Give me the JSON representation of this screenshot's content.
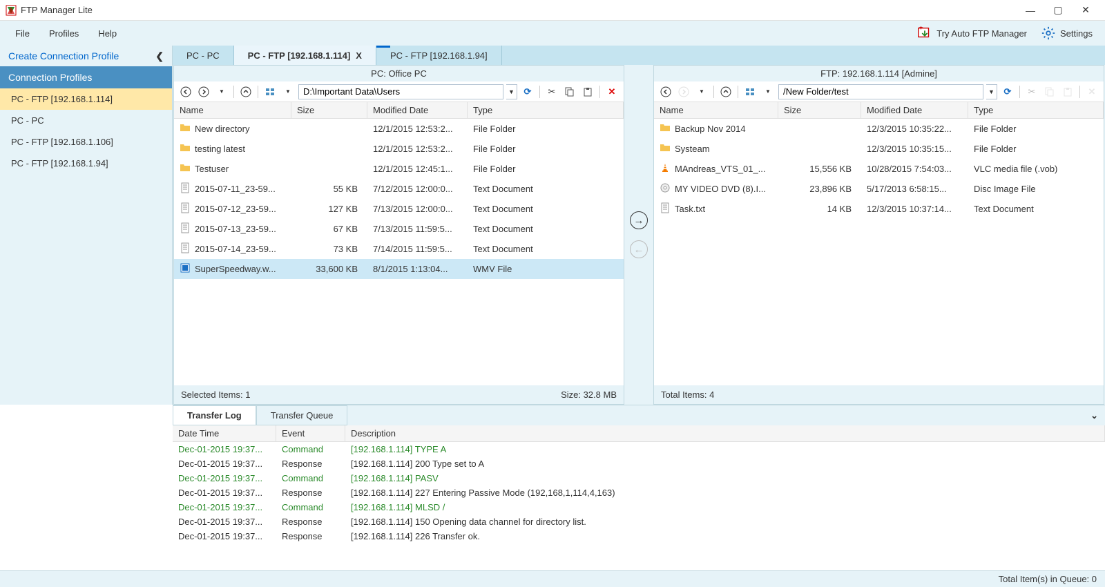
{
  "app": {
    "title": "FTP Manager Lite"
  },
  "menu": {
    "file": "File",
    "profiles": "Profiles",
    "help": "Help",
    "try_auto": "Try Auto FTP Manager",
    "settings": "Settings"
  },
  "sidebar": {
    "create": "Create Connection Profile",
    "section": "Connection Profiles",
    "items": [
      {
        "label": "PC - FTP [192.168.1.114]",
        "selected": true
      },
      {
        "label": "PC - PC",
        "selected": false
      },
      {
        "label": "PC - FTP [192.168.1.106]",
        "selected": false
      },
      {
        "label": "PC - FTP [192.168.1.94]",
        "selected": false
      }
    ]
  },
  "tabs": [
    {
      "label": "PC - PC",
      "active": false
    },
    {
      "label": "PC - FTP [192.168.1.114]",
      "active": true,
      "closable": true
    },
    {
      "label": "PC - FTP [192.168.1.94]",
      "active": false,
      "progress": true
    }
  ],
  "left_pane": {
    "title": "PC: Office PC",
    "path": "D:\\Important Data\\Users",
    "columns": {
      "name": "Name",
      "size": "Size",
      "date": "Modified Date",
      "type": "Type"
    },
    "rows": [
      {
        "icon": "folder",
        "name": "New directory",
        "size": "",
        "date": "12/1/2015 12:53:2...",
        "type": "File Folder"
      },
      {
        "icon": "folder",
        "name": "testing latest",
        "size": "",
        "date": "12/1/2015 12:53:2...",
        "type": "File Folder"
      },
      {
        "icon": "folder",
        "name": "Testuser",
        "size": "",
        "date": "12/1/2015 12:45:1...",
        "type": "File Folder"
      },
      {
        "icon": "txt",
        "name": "2015-07-11_23-59...",
        "size": "55 KB",
        "date": "7/12/2015 12:00:0...",
        "type": "Text Document"
      },
      {
        "icon": "txt",
        "name": "2015-07-12_23-59...",
        "size": "127 KB",
        "date": "7/13/2015 12:00:0...",
        "type": "Text Document"
      },
      {
        "icon": "txt",
        "name": "2015-07-13_23-59...",
        "size": "67 KB",
        "date": "7/13/2015 11:59:5...",
        "type": "Text Document"
      },
      {
        "icon": "txt",
        "name": "2015-07-14_23-59...",
        "size": "73 KB",
        "date": "7/14/2015 11:59:5...",
        "type": "Text Document"
      },
      {
        "icon": "wmv",
        "name": "SuperSpeedway.w...",
        "size": "33,600 KB",
        "date": "8/1/2015 1:13:04...",
        "type": "WMV File",
        "selected": true
      }
    ],
    "status_left": "Selected Items: 1",
    "status_right": "Size: 32.8 MB"
  },
  "right_pane": {
    "title": "FTP: 192.168.1.114 [Admine]",
    "path": "/New Folder/test",
    "columns": {
      "name": "Name",
      "size": "Size",
      "date": "Modified Date",
      "type": "Type"
    },
    "rows": [
      {
        "icon": "folder",
        "name": "Backup Nov 2014",
        "size": "",
        "date": "12/3/2015 10:35:22...",
        "type": "File Folder"
      },
      {
        "icon": "folder",
        "name": "Systeam",
        "size": "",
        "date": "12/3/2015 10:35:15...",
        "type": "File Folder"
      },
      {
        "icon": "vlc",
        "name": "MAndreas_VTS_01_...",
        "size": "15,556 KB",
        "date": "10/28/2015 7:54:03...",
        "type": "VLC media file (.vob)"
      },
      {
        "icon": "iso",
        "name": "MY VIDEO DVD (8).I...",
        "size": "23,896 KB",
        "date": "5/17/2013 6:58:15...",
        "type": "Disc Image File"
      },
      {
        "icon": "txt",
        "name": "Task.txt",
        "size": "14 KB",
        "date": "12/3/2015 10:37:14...",
        "type": "Text Document"
      }
    ],
    "status_left": "Total Items: 4",
    "status_right": ""
  },
  "bottom": {
    "tabs": {
      "log": "Transfer Log",
      "queue": "Transfer Queue"
    },
    "columns": {
      "dt": "Date Time",
      "ev": "Event",
      "desc": "Description"
    },
    "rows": [
      {
        "dt": "Dec-01-2015 19:37...",
        "ev": "Command",
        "desc": "[192.168.1.114] TYPE A",
        "cmd": true
      },
      {
        "dt": "Dec-01-2015 19:37...",
        "ev": "Response",
        "desc": "[192.168.1.114] 200 Type set to A"
      },
      {
        "dt": "Dec-01-2015 19:37...",
        "ev": "Command",
        "desc": "[192.168.1.114] PASV",
        "cmd": true
      },
      {
        "dt": "Dec-01-2015 19:37...",
        "ev": "Response",
        "desc": "[192.168.1.114] 227 Entering Passive Mode (192,168,1,114,4,163)"
      },
      {
        "dt": "Dec-01-2015 19:37...",
        "ev": "Command",
        "desc": "[192.168.1.114] MLSD /",
        "cmd": true
      },
      {
        "dt": "Dec-01-2015 19:37...",
        "ev": "Response",
        "desc": "[192.168.1.114] 150 Opening data channel for directory list."
      },
      {
        "dt": "Dec-01-2015 19:37...",
        "ev": "Response",
        "desc": "[192.168.1.114] 226 Transfer ok."
      }
    ]
  },
  "statusbar": {
    "queue": "Total Item(s) in Queue: 0"
  }
}
